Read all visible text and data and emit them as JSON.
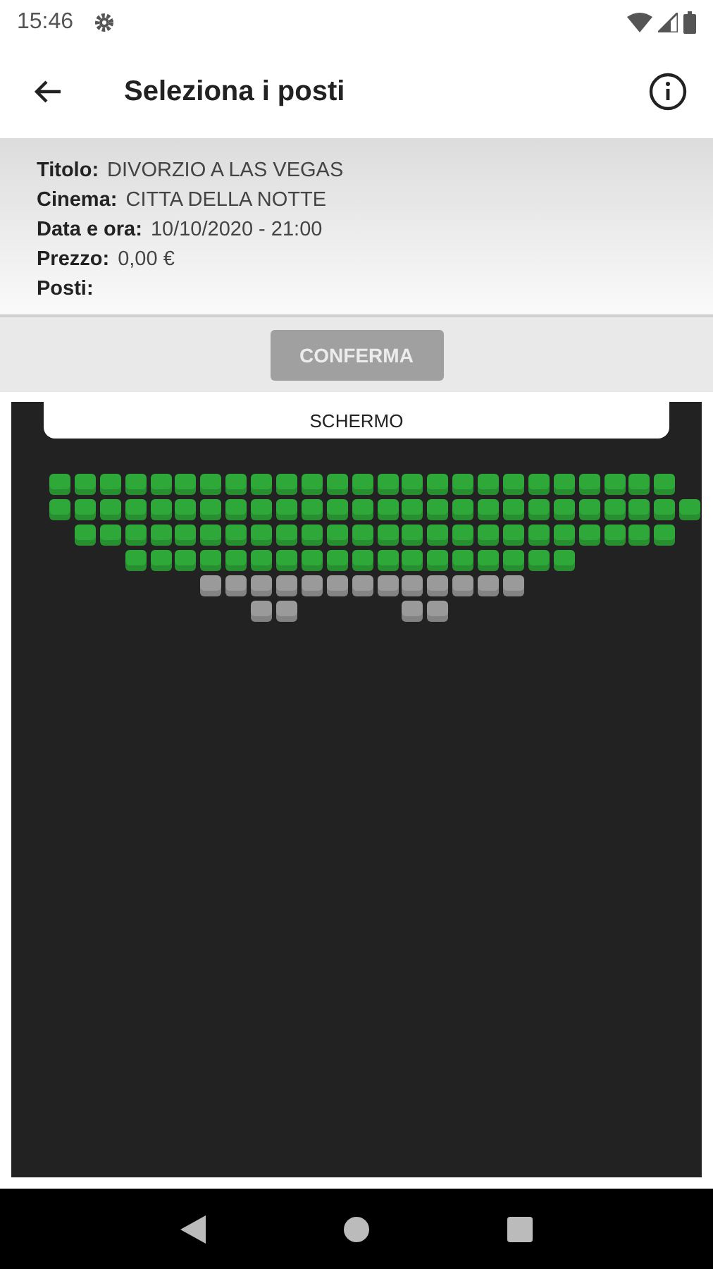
{
  "status_bar": {
    "time": "15:46"
  },
  "app_bar": {
    "title": "Seleziona i posti"
  },
  "info": [
    {
      "label": "Titolo:",
      "value": "DIVORZIO A LAS VEGAS"
    },
    {
      "label": "Cinema:",
      "value": "CITTA DELLA NOTTE"
    },
    {
      "label": "Data e ora:",
      "value": "10/10/2020 - 21:00"
    },
    {
      "label": "Prezzo:",
      "value": "0,00 €"
    },
    {
      "label": "Posti:"
    }
  ],
  "confirm_button": {
    "label": "CONFERMA",
    "disabled": true
  },
  "screen_label": "SCHERMO",
  "seat_rows": [
    {
      "seats": [
        {
          "kind": "seat",
          "taken": false
        },
        {
          "kind": "seat",
          "taken": false
        },
        {
          "kind": "seat",
          "taken": false
        },
        {
          "kind": "seat",
          "taken": false
        },
        {
          "kind": "seat",
          "taken": false
        },
        {
          "kind": "seat",
          "taken": false
        },
        {
          "kind": "seat",
          "taken": false
        },
        {
          "kind": "seat",
          "taken": false
        },
        {
          "kind": "seat",
          "taken": false
        },
        {
          "kind": "seat",
          "taken": false
        },
        {
          "kind": "seat",
          "taken": false
        },
        {
          "kind": "seat",
          "taken": false
        },
        {
          "kind": "seat",
          "taken": false
        },
        {
          "kind": "seat",
          "taken": false
        },
        {
          "kind": "seat",
          "taken": false
        },
        {
          "kind": "seat",
          "taken": false
        },
        {
          "kind": "seat",
          "taken": false
        },
        {
          "kind": "seat",
          "taken": false
        },
        {
          "kind": "seat",
          "taken": false
        },
        {
          "kind": "seat",
          "taken": false
        },
        {
          "kind": "seat",
          "taken": false
        },
        {
          "kind": "seat",
          "taken": false
        },
        {
          "kind": "seat",
          "taken": false
        },
        {
          "kind": "seat",
          "taken": false
        },
        {
          "kind": "seat",
          "taken": false
        },
        {
          "kind": "space"
        }
      ]
    },
    {
      "seats": [
        {
          "kind": "seat",
          "taken": false
        },
        {
          "kind": "seat",
          "taken": false
        },
        {
          "kind": "seat",
          "taken": false
        },
        {
          "kind": "seat",
          "taken": false
        },
        {
          "kind": "seat",
          "taken": false
        },
        {
          "kind": "seat",
          "taken": false
        },
        {
          "kind": "seat",
          "taken": false
        },
        {
          "kind": "seat",
          "taken": false
        },
        {
          "kind": "seat",
          "taken": false
        },
        {
          "kind": "seat",
          "taken": false
        },
        {
          "kind": "seat",
          "taken": false
        },
        {
          "kind": "seat",
          "taken": false
        },
        {
          "kind": "seat",
          "taken": false
        },
        {
          "kind": "seat",
          "taken": false
        },
        {
          "kind": "seat",
          "taken": false
        },
        {
          "kind": "seat",
          "taken": false
        },
        {
          "kind": "seat",
          "taken": false
        },
        {
          "kind": "seat",
          "taken": false
        },
        {
          "kind": "seat",
          "taken": false
        },
        {
          "kind": "seat",
          "taken": false
        },
        {
          "kind": "seat",
          "taken": false
        },
        {
          "kind": "seat",
          "taken": false
        },
        {
          "kind": "seat",
          "taken": false
        },
        {
          "kind": "seat",
          "taken": false
        },
        {
          "kind": "seat",
          "taken": false
        },
        {
          "kind": "seat",
          "taken": false
        }
      ]
    },
    {
      "seats": [
        {
          "kind": "space"
        },
        {
          "kind": "seat",
          "taken": false
        },
        {
          "kind": "seat",
          "taken": false
        },
        {
          "kind": "seat",
          "taken": false
        },
        {
          "kind": "seat",
          "taken": false
        },
        {
          "kind": "seat",
          "taken": false
        },
        {
          "kind": "seat",
          "taken": false
        },
        {
          "kind": "seat",
          "taken": false
        },
        {
          "kind": "seat",
          "taken": false
        },
        {
          "kind": "seat",
          "taken": false
        },
        {
          "kind": "seat",
          "taken": false
        },
        {
          "kind": "seat",
          "taken": false
        },
        {
          "kind": "seat",
          "taken": false
        },
        {
          "kind": "seat",
          "taken": false
        },
        {
          "kind": "seat",
          "taken": false
        },
        {
          "kind": "seat",
          "taken": false
        },
        {
          "kind": "seat",
          "taken": false
        },
        {
          "kind": "seat",
          "taken": false
        },
        {
          "kind": "seat",
          "taken": false
        },
        {
          "kind": "seat",
          "taken": false
        },
        {
          "kind": "seat",
          "taken": false
        },
        {
          "kind": "seat",
          "taken": false
        },
        {
          "kind": "seat",
          "taken": false
        },
        {
          "kind": "seat",
          "taken": false
        },
        {
          "kind": "seat",
          "taken": false
        },
        {
          "kind": "space"
        }
      ]
    },
    {
      "seats": [
        {
          "kind": "space"
        },
        {
          "kind": "space"
        },
        {
          "kind": "space"
        },
        {
          "kind": "seat",
          "taken": false
        },
        {
          "kind": "seat",
          "taken": false
        },
        {
          "kind": "seat",
          "taken": false
        },
        {
          "kind": "seat",
          "taken": false
        },
        {
          "kind": "seat",
          "taken": false
        },
        {
          "kind": "seat",
          "taken": false
        },
        {
          "kind": "seat",
          "taken": false
        },
        {
          "kind": "seat",
          "taken": false
        },
        {
          "kind": "seat",
          "taken": false
        },
        {
          "kind": "seat",
          "taken": false
        },
        {
          "kind": "seat",
          "taken": false
        },
        {
          "kind": "seat",
          "taken": false
        },
        {
          "kind": "seat",
          "taken": false
        },
        {
          "kind": "seat",
          "taken": false
        },
        {
          "kind": "seat",
          "taken": false
        },
        {
          "kind": "seat",
          "taken": false
        },
        {
          "kind": "seat",
          "taken": false
        },
        {
          "kind": "seat",
          "taken": false
        }
      ]
    },
    {
      "seats": [
        {
          "kind": "space"
        },
        {
          "kind": "space"
        },
        {
          "kind": "space"
        },
        {
          "kind": "space"
        },
        {
          "kind": "space"
        },
        {
          "kind": "space"
        },
        {
          "kind": "seat",
          "taken": true
        },
        {
          "kind": "seat",
          "taken": true
        },
        {
          "kind": "seat",
          "taken": true
        },
        {
          "kind": "seat",
          "taken": true
        },
        {
          "kind": "seat",
          "taken": true
        },
        {
          "kind": "seat",
          "taken": true
        },
        {
          "kind": "seat",
          "taken": true
        },
        {
          "kind": "seat",
          "taken": true
        },
        {
          "kind": "seat",
          "taken": true
        },
        {
          "kind": "seat",
          "taken": true
        },
        {
          "kind": "seat",
          "taken": true
        },
        {
          "kind": "seat",
          "taken": true
        },
        {
          "kind": "seat",
          "taken": true
        }
      ]
    },
    {
      "seats": [
        {
          "kind": "space"
        },
        {
          "kind": "space"
        },
        {
          "kind": "space"
        },
        {
          "kind": "space"
        },
        {
          "kind": "space"
        },
        {
          "kind": "space"
        },
        {
          "kind": "space"
        },
        {
          "kind": "space"
        },
        {
          "kind": "seat",
          "taken": true
        },
        {
          "kind": "seat",
          "taken": true
        },
        {
          "kind": "space"
        },
        {
          "kind": "space"
        },
        {
          "kind": "space"
        },
        {
          "kind": "space"
        },
        {
          "kind": "seat",
          "taken": true
        },
        {
          "kind": "seat",
          "taken": true
        }
      ]
    }
  ]
}
